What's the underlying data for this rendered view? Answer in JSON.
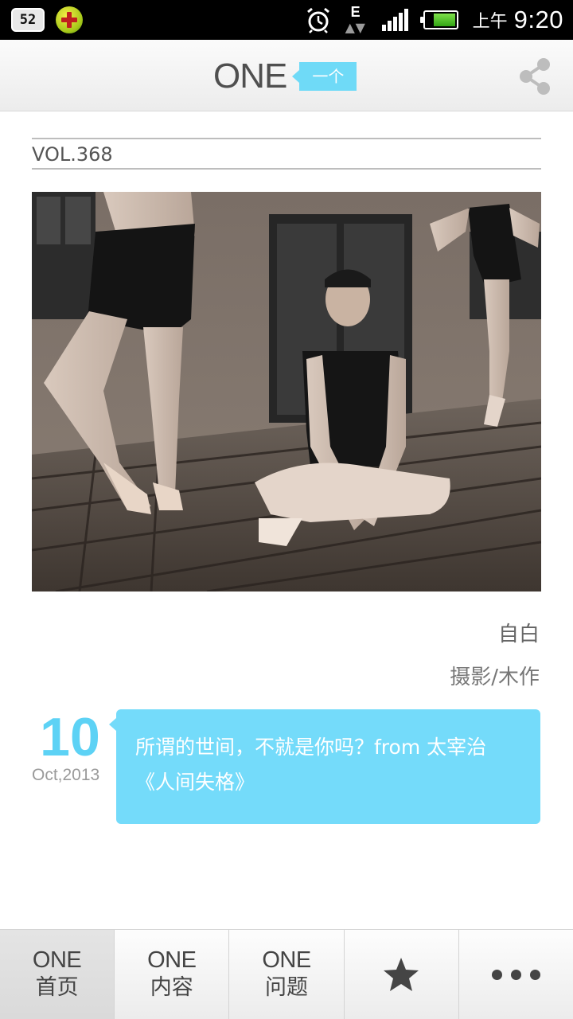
{
  "status_bar": {
    "notif_badge": "52",
    "time_prefix": "上午",
    "time": "9:20",
    "network": "E",
    "battery_level": 0.75
  },
  "header": {
    "logo_text": "ONE",
    "logo_tag": "一个"
  },
  "main": {
    "volume": "VOL.368",
    "photo_title": "自白",
    "photo_author": "摄影/木作",
    "date_day": "10",
    "date_month_year": "Oct,2013",
    "quote": "所谓的世间，不就是你吗？from 太宰治《人间失格》"
  },
  "bottom_nav": {
    "items": [
      {
        "top": "ONE",
        "bottom": "首页",
        "active": true
      },
      {
        "top": "ONE",
        "bottom": "内容",
        "active": false
      },
      {
        "top": "ONE",
        "bottom": "问题",
        "active": false
      },
      {
        "icon": "star-icon"
      },
      {
        "icon": "more-icon"
      }
    ]
  },
  "colors": {
    "accent": "#74dbfa",
    "date_color": "#5dd2f5",
    "text": "#555555"
  }
}
